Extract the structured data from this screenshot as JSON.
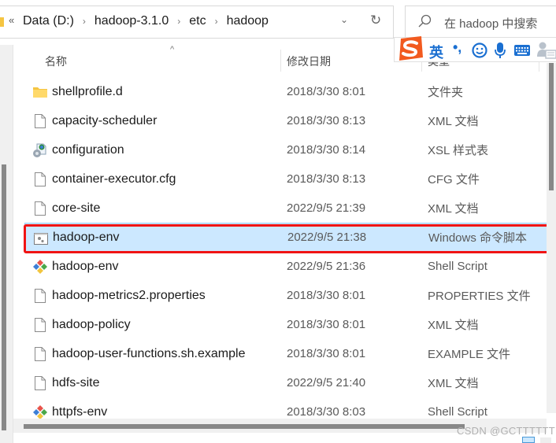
{
  "address_bar": {
    "overflow": "«",
    "crumbs": [
      "Data (D:)",
      "hadoop-3.1.0",
      "etc",
      "hadoop"
    ],
    "separator": "›",
    "dropdown": "⌄",
    "refresh": "↻"
  },
  "search": {
    "placeholder": "在 hadoop 中搜索"
  },
  "ime": {
    "language": "英",
    "punctuation": "•,"
  },
  "columns": {
    "name": "名称",
    "date": "修改日期",
    "type": "类型",
    "sort_indicator": "^"
  },
  "files": [
    {
      "name": "shellprofile.d",
      "date": "2018/3/30 8:01",
      "type": "文件夹",
      "icon": "folder-icon"
    },
    {
      "name": "capacity-scheduler",
      "date": "2018/3/30 8:13",
      "type": "XML 文档",
      "icon": "file-icon"
    },
    {
      "name": "configuration",
      "date": "2018/3/30 8:14",
      "type": "XSL 样式表",
      "icon": "xsl-file-icon"
    },
    {
      "name": "container-executor.cfg",
      "date": "2018/3/30 8:13",
      "type": "CFG 文件",
      "icon": "file-icon"
    },
    {
      "name": "core-site",
      "date": "2022/9/5 21:39",
      "type": "XML 文档",
      "icon": "file-icon"
    },
    {
      "name": "hadoop-env",
      "date": "2022/9/5 21:38",
      "type": "Windows 命令脚本",
      "icon": "cmd-script-icon",
      "selected": true
    },
    {
      "name": "hadoop-env",
      "date": "2022/9/5 21:36",
      "type": "Shell Script",
      "icon": "shell-script-icon"
    },
    {
      "name": "hadoop-metrics2.properties",
      "date": "2018/3/30 8:01",
      "type": "PROPERTIES 文件",
      "icon": "file-icon"
    },
    {
      "name": "hadoop-policy",
      "date": "2018/3/30 8:01",
      "type": "XML 文档",
      "icon": "file-icon"
    },
    {
      "name": "hadoop-user-functions.sh.example",
      "date": "2018/3/30 8:01",
      "type": "EXAMPLE 文件",
      "icon": "file-icon"
    },
    {
      "name": "hdfs-site",
      "date": "2022/9/5 21:40",
      "type": "XML 文档",
      "icon": "file-icon"
    },
    {
      "name": "httpfs-env",
      "date": "2018/3/30 8:03",
      "type": "Shell Script",
      "icon": "shell-script-icon"
    }
  ],
  "watermark": "CSDN @GCTTTTTT",
  "colors": {
    "selection_bg": "#cce8ff",
    "selection_border": "#99d1ff",
    "highlight_annotation": "#f01414",
    "ime_blue": "#1a6fd1",
    "ime_logo_orange": "#f25a1f"
  }
}
